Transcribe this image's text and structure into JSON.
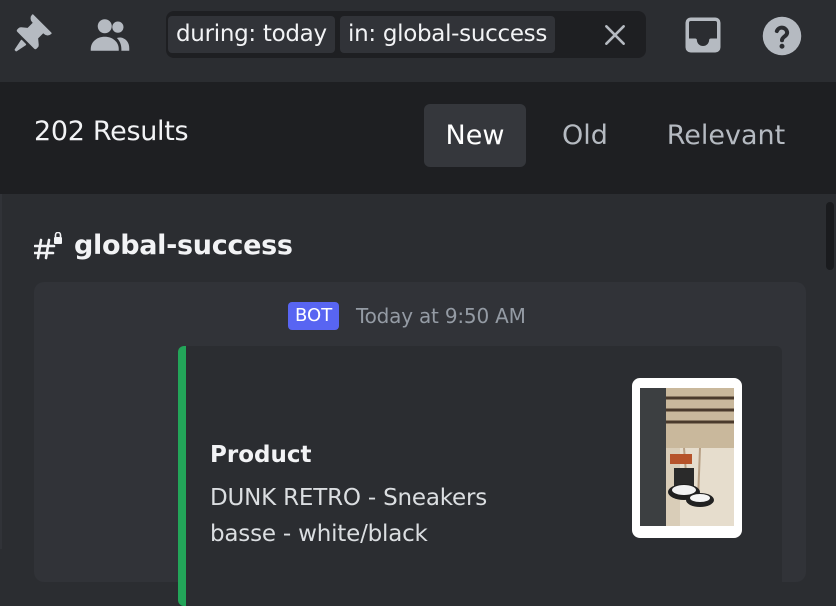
{
  "toolbar": {
    "icons": [
      "pin-icon",
      "members-icon",
      "inbox-icon",
      "help-icon"
    ]
  },
  "search": {
    "filters": [
      "during: today",
      "in:  global-success"
    ]
  },
  "results": {
    "count_label": "202 Results",
    "sort_tabs": [
      {
        "label": "New",
        "active": true
      },
      {
        "label": "Old",
        "active": false
      },
      {
        "label": "Relevant",
        "active": false
      }
    ]
  },
  "channel": {
    "name": "global-success"
  },
  "message": {
    "badge": "BOT",
    "timestamp": "Today at 9:50 AM",
    "embed": {
      "accent_color": "#23a559",
      "field_name": "Product",
      "field_value": "DUNK RETRO - Sneakers basse - white/black"
    }
  },
  "colors": {
    "brand": "#5865f2",
    "background": "#2b2d31",
    "header": "#1e1f22"
  }
}
